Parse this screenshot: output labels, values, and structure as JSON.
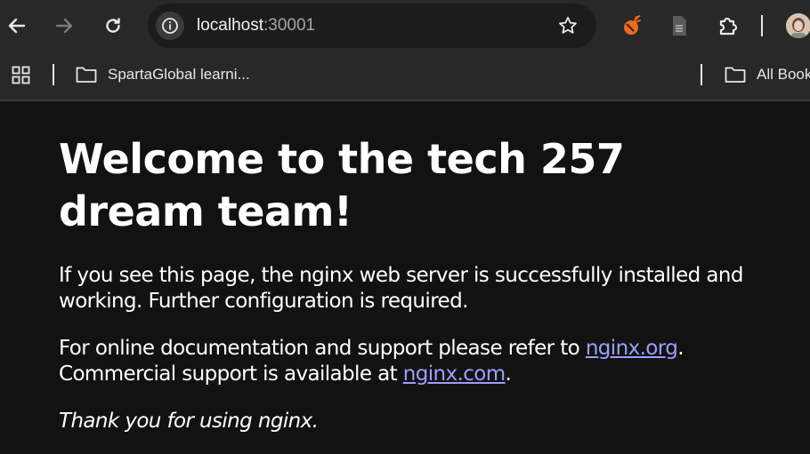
{
  "browser": {
    "address": {
      "host": "localhost",
      "port": ":30001"
    },
    "bookmarks": [
      {
        "label": "SpartaGlobal learni..."
      },
      {
        "label": "All Book"
      }
    ],
    "colors": {
      "toolbar": "#282828",
      "page_bg": "#121212",
      "link": "#9e9eff"
    },
    "icons": [
      "back-icon",
      "forward-icon",
      "reload-icon",
      "site-info-icon",
      "star-icon",
      "extension-icon",
      "document-icon",
      "puzzle-icon",
      "apps-grid-icon",
      "folder-icon"
    ]
  },
  "page": {
    "heading": "Welcome to the tech 257 dream team!",
    "para1": "If you see this page, the nginx web server is successfully installed and working. Further configuration is required.",
    "para2": {
      "before": "For online documentation and support please refer to ",
      "link1": "nginx.org",
      "middle": ".\nCommercial support is available at ",
      "link2": "nginx.com",
      "after": "."
    },
    "thanks": "Thank you for using nginx."
  }
}
